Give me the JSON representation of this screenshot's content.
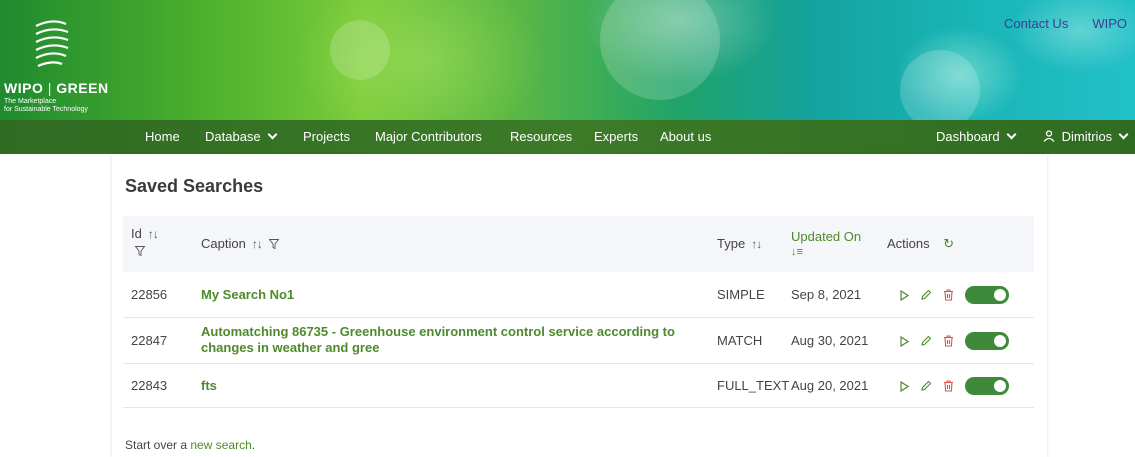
{
  "header": {
    "logo_wordmark_left": "WIPO",
    "logo_wordmark_right": "GREEN",
    "tagline_line1": "The Marketplace",
    "tagline_line2": "for Sustainable Technology",
    "top_links": [
      "Contact Us",
      "WIPO"
    ]
  },
  "nav": {
    "items": [
      "Home",
      "Database",
      "Projects",
      "Major Contributors",
      "Resources",
      "Experts",
      "About us"
    ],
    "dashboard": "Dashboard",
    "user": "Dimitrios"
  },
  "page": {
    "title": "Saved Searches",
    "columns": {
      "id": "Id",
      "caption": "Caption",
      "type": "Type",
      "updated": "Updated On",
      "actions": "Actions"
    },
    "rows": [
      {
        "id": "22856",
        "caption": "My Search No1",
        "type": "SIMPLE",
        "updated": "Sep 8, 2021",
        "enabled": true
      },
      {
        "id": "22847",
        "caption": "Automatching 86735 - Greenhouse environment control service according to changes in weather and gree",
        "type": "MATCH",
        "updated": "Aug 30, 2021",
        "enabled": true
      },
      {
        "id": "22843",
        "caption": "fts",
        "type": "FULL_TEXT",
        "updated": "Aug 20, 2021",
        "enabled": true
      }
    ],
    "footer_prefix": "Start over a ",
    "footer_link": "new search",
    "footer_suffix": "."
  },
  "icons": {
    "sort": "sort-arrows-icon",
    "filter": "filter-funnel-icon",
    "refresh": "refresh-icon",
    "run": "play-icon",
    "edit": "pencil-icon",
    "delete": "trash-icon"
  },
  "colors": {
    "brand_green": "#4e8a2c",
    "nav_green": "#3c7b28",
    "delete_red": "#d9534f",
    "toggle_on": "#3e8a3a",
    "link_blue": "#3a3f8f"
  }
}
